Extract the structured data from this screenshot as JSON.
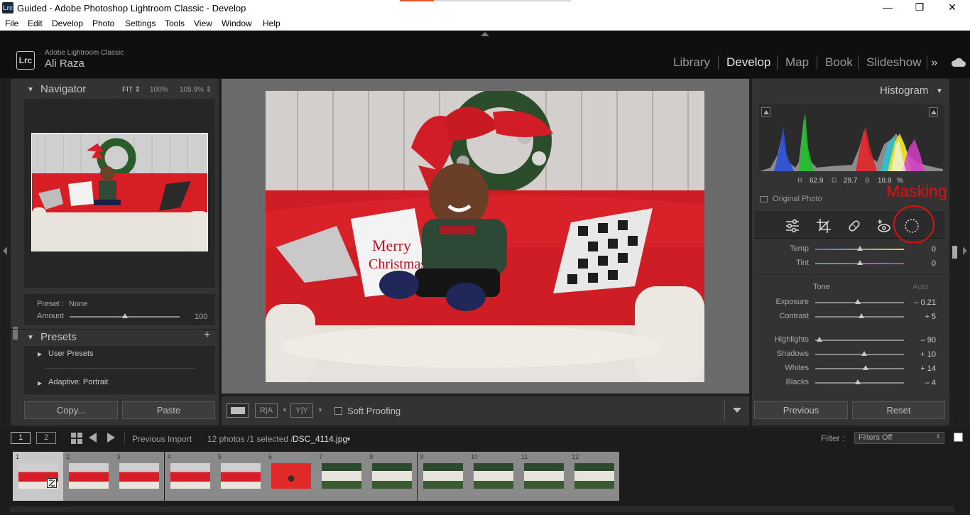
{
  "window": {
    "title": "Guided - Adobe Photoshop Lightroom Classic - Develop",
    "logo": "Lrc",
    "controls": {
      "minimize": "—",
      "maximize": "❐",
      "close": "✕"
    }
  },
  "menu": [
    "File",
    "Edit",
    "Develop",
    "Photo",
    "Settings",
    "Tools",
    "View",
    "Window",
    "Help"
  ],
  "identity": {
    "app": "Adobe Lightroom Classic",
    "user": "Ali Raza",
    "logo": "Lrc"
  },
  "modules": [
    "Library",
    "Develop",
    "Map",
    "Book",
    "Slideshow"
  ],
  "active_module": "Develop",
  "more_modules": "»",
  "navigator": {
    "title": "Navigator",
    "zoom": [
      "FIT ⇕",
      "100%",
      "105.9% ⇕"
    ],
    "preset_label": "Preset :",
    "preset_value": "None",
    "amount_label": "Amount",
    "amount_value": "100",
    "amount_fraction": 0.5
  },
  "presets": {
    "title": "Presets",
    "add": "+",
    "items": [
      "User Presets",
      "Adaptive: Portrait"
    ]
  },
  "left_buttons": {
    "copy": "Copy...",
    "paste": "Paste"
  },
  "toolbar": {
    "soft_proofing": "Soft Proofing",
    "view_ry": "R|A",
    "compare": "Y|Y"
  },
  "histogram": {
    "title": "Histogram",
    "r_label": "R",
    "r_value": "62.9",
    "g_label": "G",
    "g_value": "29.7",
    "b_label": "B",
    "b_value": "18.9",
    "pct": "%",
    "original_photo": "Original Photo"
  },
  "annotation": {
    "masking": "Masking",
    "color": "#e01010"
  },
  "basic": {
    "temp": {
      "label": "Temp",
      "value": "0",
      "fraction": 0.5
    },
    "tint": {
      "label": "Tint",
      "value": "0",
      "fraction": 0.5
    },
    "tone_label": "Tone",
    "auto_label": "Auto",
    "exposure": {
      "label": "Exposure",
      "value": "– 0.21",
      "fraction": 0.48
    },
    "contrast": {
      "label": "Contrast",
      "value": "+ 5",
      "fraction": 0.52
    },
    "highlights": {
      "label": "Highlights",
      "value": "– 90",
      "fraction": 0.05
    },
    "shadows": {
      "label": "Shadows",
      "value": "+ 10",
      "fraction": 0.55
    },
    "whites": {
      "label": "Whites",
      "value": "+ 14",
      "fraction": 0.57
    },
    "blacks": {
      "label": "Blacks",
      "value": "– 4",
      "fraction": 0.48
    }
  },
  "right_buttons": {
    "previous": "Previous",
    "reset": "Reset"
  },
  "filmstrip_bar": {
    "screen1": "1",
    "screen2": "2",
    "source": "Previous Import",
    "count": "12 photos /1 selected /",
    "filename": "DSC_4114.jpg",
    "filter_label": "Filter :",
    "filter_value": "Filters Off"
  },
  "thumbnails": [
    {
      "n": "1",
      "kind": "red"
    },
    {
      "n": "2",
      "kind": "red"
    },
    {
      "n": "3",
      "kind": "red"
    },
    {
      "n": "4",
      "kind": "red"
    },
    {
      "n": "5",
      "kind": "red"
    },
    {
      "n": "6",
      "kind": "solid"
    },
    {
      "n": "7",
      "kind": "green"
    },
    {
      "n": "8",
      "kind": "green"
    },
    {
      "n": "9",
      "kind": "green"
    },
    {
      "n": "10",
      "kind": "green"
    },
    {
      "n": "11",
      "kind": "green"
    },
    {
      "n": "12",
      "kind": "green"
    }
  ],
  "colors": {
    "panel": "#333333",
    "accent": "#e01010"
  }
}
